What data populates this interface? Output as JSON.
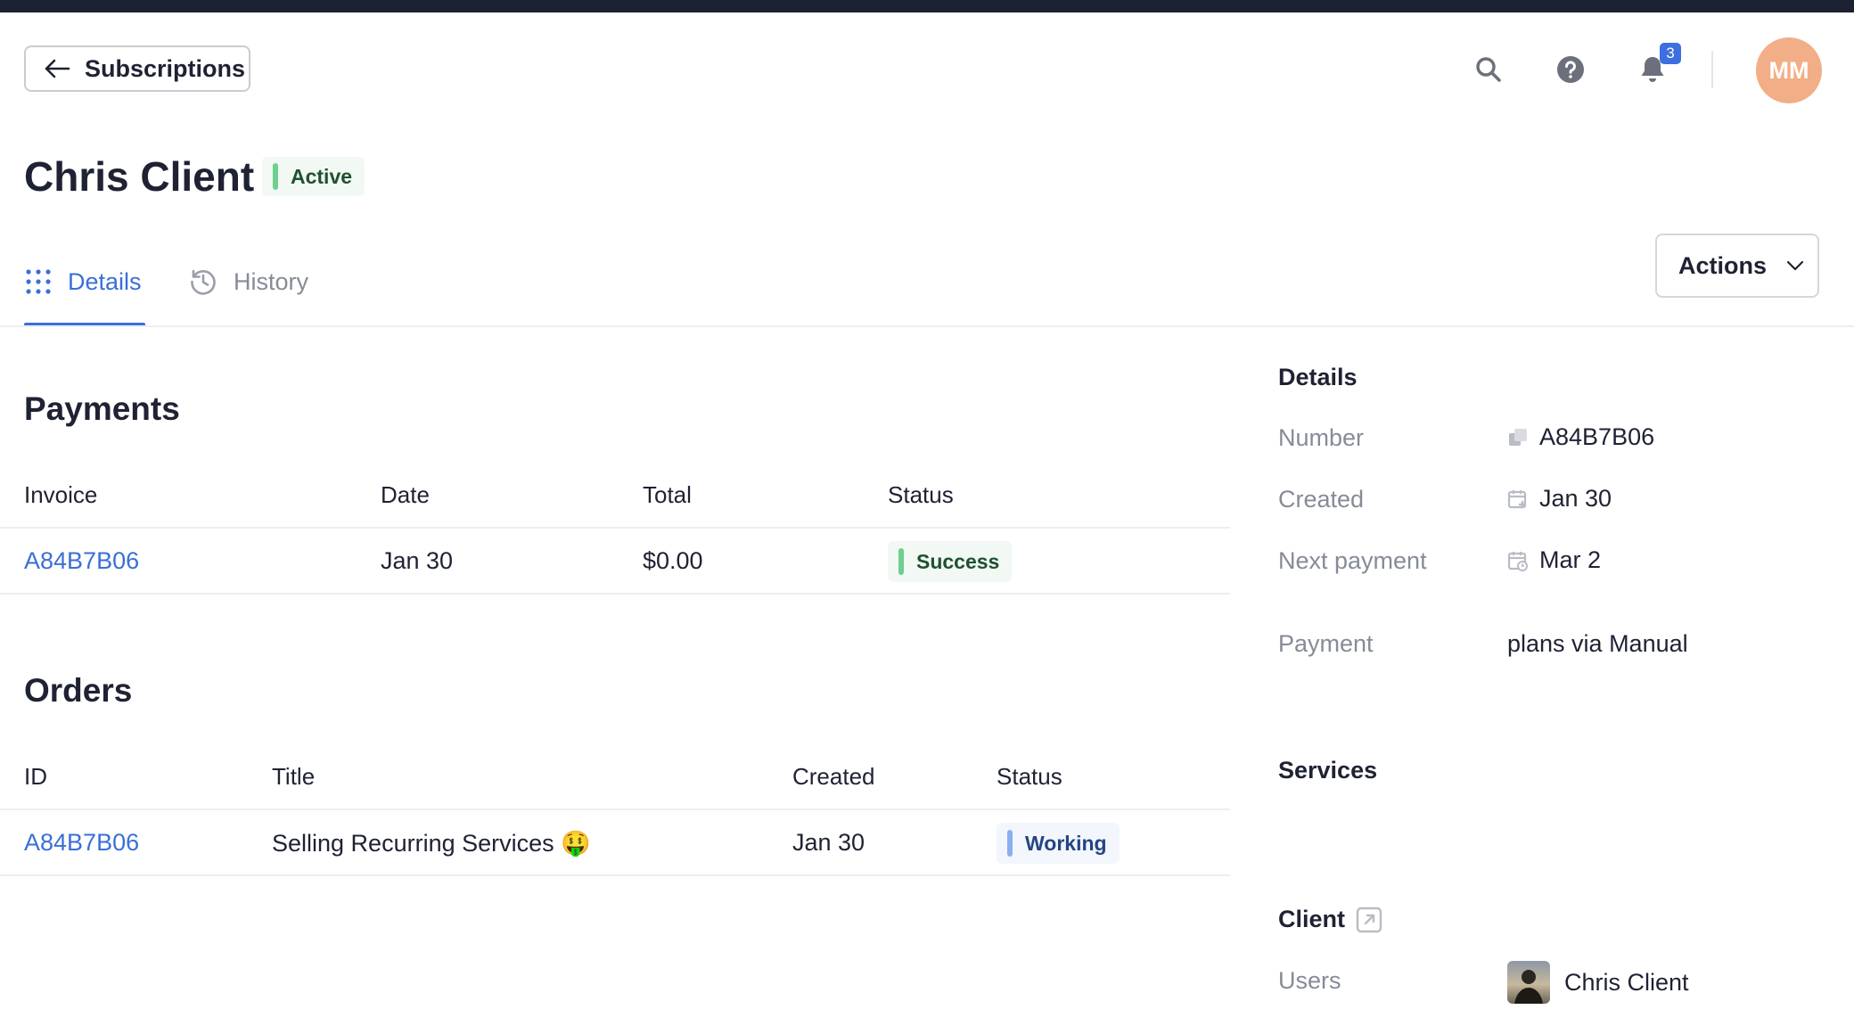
{
  "header": {
    "back_label": "Subscriptions",
    "notification_count": "3",
    "avatar_initials": "MM"
  },
  "page": {
    "title": "Chris Client",
    "status": "Active"
  },
  "tabs": [
    {
      "label": "Details",
      "active": true
    },
    {
      "label": "History",
      "active": false
    }
  ],
  "actions_label": "Actions",
  "payments": {
    "title": "Payments",
    "columns": [
      "Invoice",
      "Date",
      "Total",
      "Status"
    ],
    "rows": [
      {
        "invoice": "A84B7B06",
        "date": "Jan 30",
        "total": "$0.00",
        "status": "Success"
      }
    ]
  },
  "orders": {
    "title": "Orders",
    "columns": [
      "ID",
      "Title",
      "Created",
      "Status"
    ],
    "rows": [
      {
        "id": "A84B7B06",
        "title": "Selling Recurring Services 🤑",
        "created": "Jan 30",
        "status": "Working"
      }
    ]
  },
  "details": {
    "title": "Details",
    "number_label": "Number",
    "number_value": "A84B7B06",
    "created_label": "Created",
    "created_value": "Jan 30",
    "next_payment_label": "Next payment",
    "next_payment_value": "Mar 2",
    "payment_label": "Payment",
    "payment_value": "plans via Manual"
  },
  "services": {
    "title": "Services"
  },
  "client": {
    "title": "Client",
    "users_label": "Users",
    "user_name": "Chris Client"
  },
  "colors": {
    "accent": "#3a6fd8",
    "topbar": "#1c2233",
    "avatar": "#f2ae86",
    "success_bar": "#6ed08e",
    "working_bar": "#8aaef0"
  }
}
